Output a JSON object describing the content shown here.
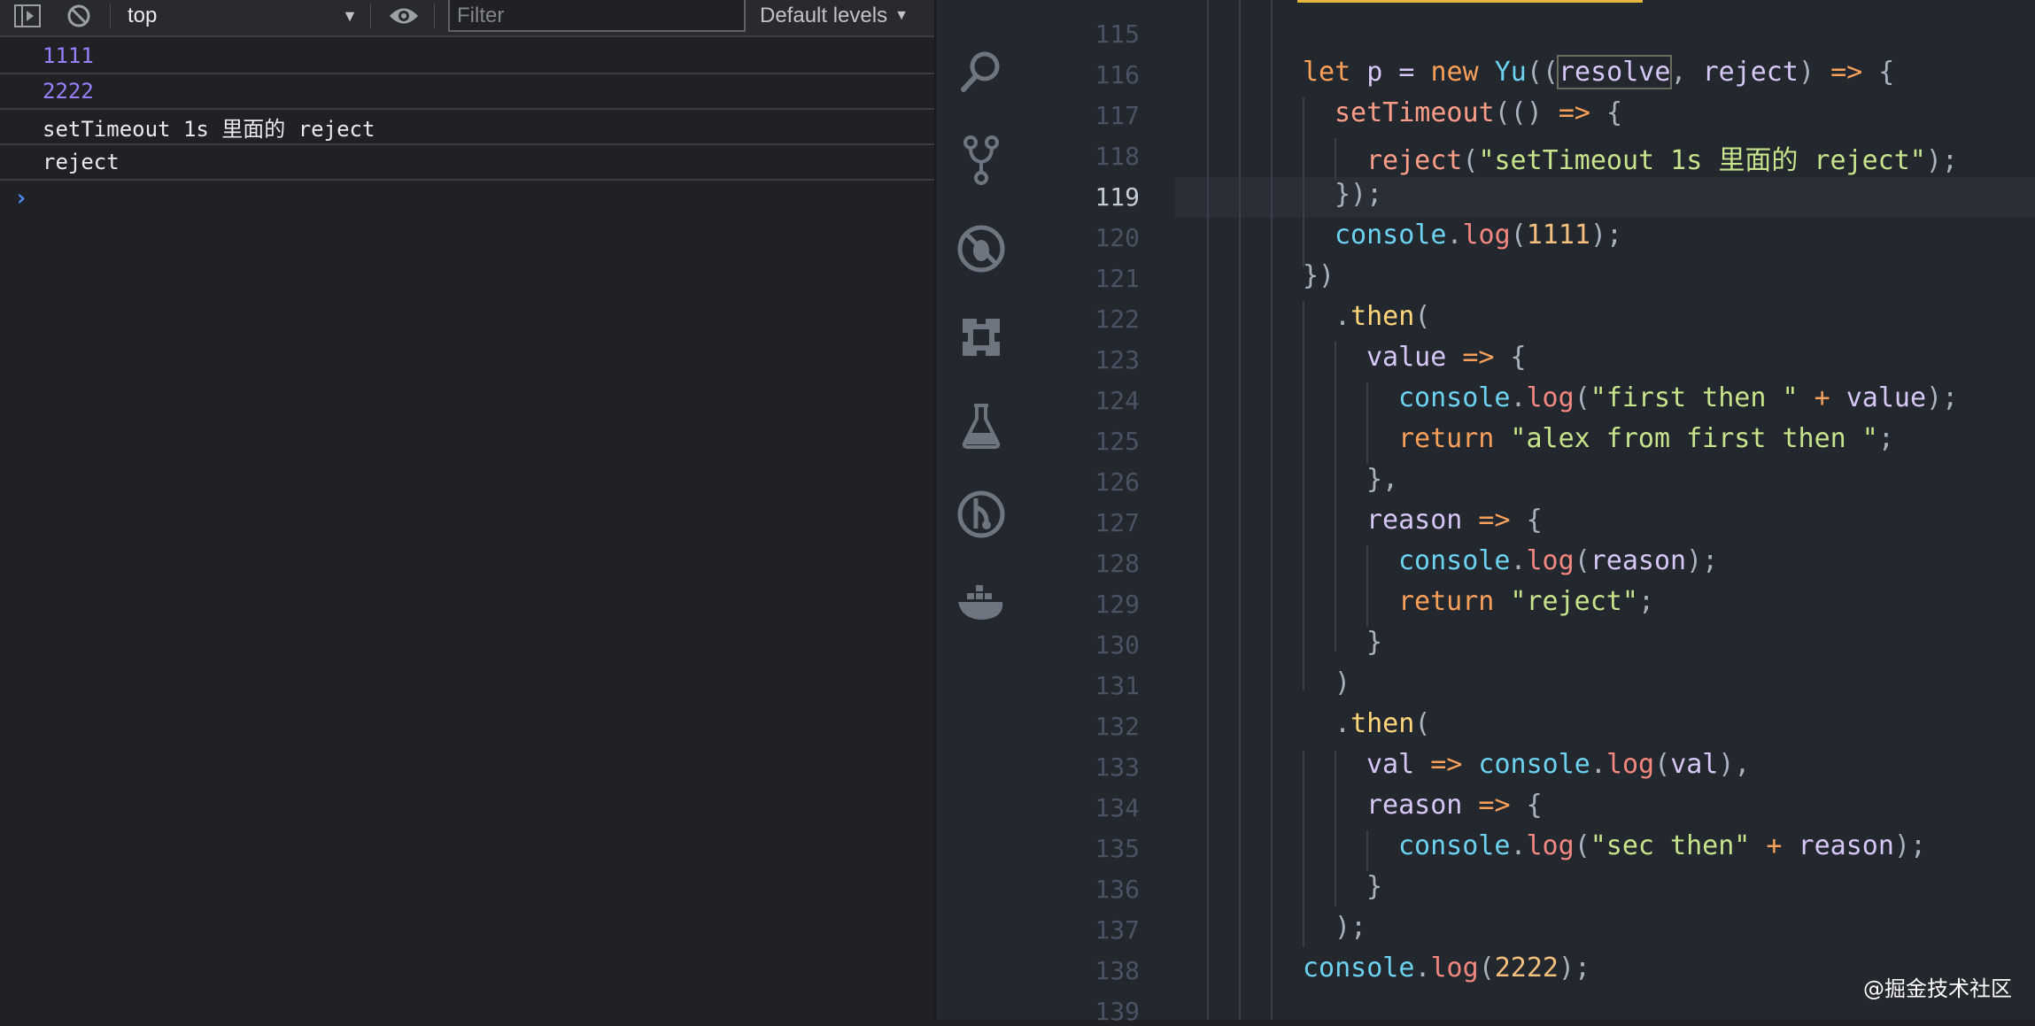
{
  "console": {
    "toolbar": {
      "context": "top",
      "filter_placeholder": "Filter",
      "levels": "Default levels"
    },
    "messages": [
      {
        "text": "1111",
        "kind": "number"
      },
      {
        "text": "2222",
        "kind": "number"
      },
      {
        "text": "setTimeout 1s 里面的 reject",
        "kind": "string"
      },
      {
        "text": "reject",
        "kind": "string"
      }
    ],
    "prompt": "›"
  },
  "editor": {
    "activity_icons": [
      "search-icon",
      "source-control-icon",
      "debug-icon",
      "extensions-icon",
      "test-flask-icon",
      "git-history-icon",
      "docker-icon"
    ],
    "line_numbers": [
      "115",
      "116",
      "117",
      "118",
      "119",
      "120",
      "121",
      "122",
      "123",
      "124",
      "125",
      "126",
      "127",
      "128",
      "129",
      "130",
      "131",
      "132",
      "133",
      "134",
      "135",
      "136",
      "137",
      "138",
      "139"
    ],
    "active_line": "119",
    "code": {
      "l116": {
        "kw_let": "let",
        "p": " p = ",
        "kw_new": "new",
        "cls": " Yu",
        "o": "((",
        "resolve": "resolve",
        "rest": ", ",
        "reject": "reject",
        "c": ") ",
        "arrow": "=>",
        "b": " {"
      },
      "l117": {
        "fn": "setTimeout",
        "o": "(() ",
        "arrow": "=>",
        "b": " {"
      },
      "l118": {
        "fn": "reject",
        "o": "(",
        "str": "\"setTimeout 1s 里面的 reject\"",
        "c": ");"
      },
      "l119": {
        "t": "});"
      },
      "l120": {
        "obj": "console",
        "dot": ".",
        "fn": "log",
        "o": "(",
        "num": "1111",
        "c": ");"
      },
      "l121": {
        "t": "})"
      },
      "l122": {
        "dot": ".",
        "prop": "then",
        "o": "("
      },
      "l123": {
        "var": "value",
        "arrow": " =>",
        "b": " {"
      },
      "l124": {
        "obj": "console",
        "dot": ".",
        "fn": "log",
        "o": "(",
        "str": "\"first then \"",
        "op": " +",
        "var": " value",
        "c": ");"
      },
      "l125": {
        "kw": "return",
        "str": " \"alex from first then \"",
        "c": ";"
      },
      "l126": {
        "t": "},"
      },
      "l127": {
        "var": "reason",
        "arrow": " =>",
        "b": " {"
      },
      "l128": {
        "obj": "console",
        "dot": ".",
        "fn": "log",
        "o": "(",
        "var": "reason",
        "c": ");"
      },
      "l129": {
        "kw": "return",
        "str": " \"reject\"",
        "c": ";"
      },
      "l130": {
        "t": "}"
      },
      "l131": {
        "t": ")"
      },
      "l132": {
        "dot": ".",
        "prop": "then",
        "o": "("
      },
      "l133": {
        "var": "val",
        "arrow": " =>",
        "obj": " console",
        "dot": ".",
        "fn": "log",
        "o": "(",
        "var2": "val",
        "c": "),"
      },
      "l134": {
        "var": "reason",
        "arrow": " =>",
        "b": " {"
      },
      "l135": {
        "obj": "console",
        "dot": ".",
        "fn": "log",
        "o": "(",
        "str": "\"sec then\"",
        "op": " +",
        "var": " reason",
        "c": ");"
      },
      "l136": {
        "t": "}"
      },
      "l137": {
        "t": ");"
      },
      "l138": {
        "obj": "console",
        "dot": ".",
        "fn": "log",
        "o": "(",
        "num": "2222",
        "c": ");"
      }
    }
  },
  "watermark": "@掘金技术社区",
  "colors": {
    "accent_number": "#9980ff",
    "prompt": "#4d8df6",
    "highlight_bar": "#e8b73f"
  }
}
